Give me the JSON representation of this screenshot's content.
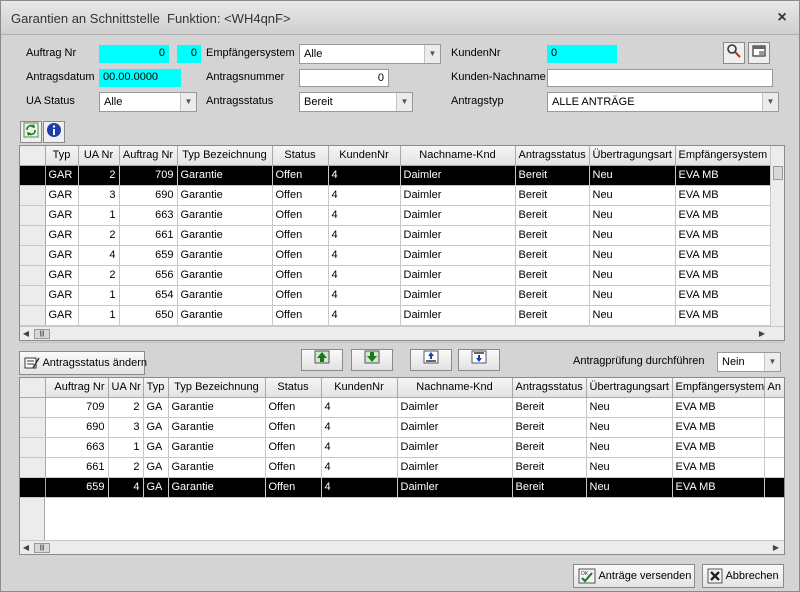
{
  "window": {
    "title": "Garantien an Schnittstelle",
    "function_label": "Funktion: <WH4qnF>",
    "close_label": "×"
  },
  "filters": {
    "auftrag_nr_label": "Auftrag Nr",
    "auftrag_nr_value": "0",
    "auftrag_nr_value2": "0",
    "empfaenger_label": "Empfängersystem",
    "empfaenger_value": "Alle",
    "kundennr_label": "KundenNr",
    "kundennr_value": "0",
    "antragsdatum_label": "Antragsdatum",
    "antragsdatum_value": "00.00.0000",
    "antragsnummer_label": "Antragsnummer",
    "antragsnummer_value": "0",
    "kunden_nachname_label": "Kunden-Nachname",
    "kunden_nachname_value": "",
    "ua_status_label": "UA Status",
    "ua_status_value": "Alle",
    "antragsstatus_label": "Antragsstatus",
    "antragsstatus_value": "Bereit",
    "antragstyp_label": "Antragstyp",
    "antragstyp_value": "ALLE ANTRÄGE"
  },
  "icons": {
    "search": "magnifier-icon",
    "window": "window-icon",
    "refresh": "refresh-icon",
    "info": "info-icon",
    "edit": "edit-icon",
    "up": "arrow-up-icon",
    "down": "arrow-down-icon",
    "top": "move-top-icon",
    "bottom": "move-bottom-icon",
    "ok": "ok-icon",
    "cancel": "cancel-icon"
  },
  "top_grid": {
    "columns": [
      "Typ",
      "UA Nr",
      "Auftrag Nr",
      "Typ Bezeichnung",
      "Status",
      "KundenNr",
      "Nachname-Knd",
      "Antragsstatus",
      "Übertragungsart",
      "Empfängersystem"
    ],
    "rows": [
      [
        "GAR",
        "2",
        "709",
        "Garantie",
        "Offen",
        "4",
        "Daimler",
        "Bereit",
        "Neu",
        "EVA MB"
      ],
      [
        "GAR",
        "3",
        "690",
        "Garantie",
        "Offen",
        "4",
        "Daimler",
        "Bereit",
        "Neu",
        "EVA MB"
      ],
      [
        "GAR",
        "1",
        "663",
        "Garantie",
        "Offen",
        "4",
        "Daimler",
        "Bereit",
        "Neu",
        "EVA MB"
      ],
      [
        "GAR",
        "2",
        "661",
        "Garantie",
        "Offen",
        "4",
        "Daimler",
        "Bereit",
        "Neu",
        "EVA MB"
      ],
      [
        "GAR",
        "4",
        "659",
        "Garantie",
        "Offen",
        "4",
        "Daimler",
        "Bereit",
        "Neu",
        "EVA MB"
      ],
      [
        "GAR",
        "2",
        "656",
        "Garantie",
        "Offen",
        "4",
        "Daimler",
        "Bereit",
        "Neu",
        "EVA MB"
      ],
      [
        "GAR",
        "1",
        "654",
        "Garantie",
        "Offen",
        "4",
        "Daimler",
        "Bereit",
        "Neu",
        "EVA MB"
      ],
      [
        "GAR",
        "1",
        "650",
        "Garantie",
        "Offen",
        "4",
        "Daimler",
        "Bereit",
        "Neu",
        "EVA MB"
      ]
    ]
  },
  "middle": {
    "change_status_label": "Antragsstatus ändern",
    "pruefung_label": "Antragprüfung durchführen",
    "pruefung_value": "Nein"
  },
  "bottom_grid": {
    "columns": [
      "Auftrag Nr",
      "UA Nr",
      "Typ",
      "Typ Bezeichnung",
      "Status",
      "KundenNr",
      "Nachname-Knd",
      "Antragsstatus",
      "Übertragungsart",
      "Empfängersystem",
      "An"
    ],
    "rows": [
      [
        "709",
        "2",
        "GA",
        "Garantie",
        "Offen",
        "4",
        "Daimler",
        "Bereit",
        "Neu",
        "EVA MB"
      ],
      [
        "690",
        "3",
        "GA",
        "Garantie",
        "Offen",
        "4",
        "Daimler",
        "Bereit",
        "Neu",
        "EVA MB"
      ],
      [
        "663",
        "1",
        "GA",
        "Garantie",
        "Offen",
        "4",
        "Daimler",
        "Bereit",
        "Neu",
        "EVA MB"
      ],
      [
        "661",
        "2",
        "GA",
        "Garantie",
        "Offen",
        "4",
        "Daimler",
        "Bereit",
        "Neu",
        "EVA MB"
      ],
      [
        "659",
        "4",
        "GA",
        "Garantie",
        "Offen",
        "4",
        "Daimler",
        "Bereit",
        "Neu",
        "EVA MB"
      ]
    ]
  },
  "footer": {
    "send_label": "Anträge versenden",
    "cancel_label": "Abbrechen"
  }
}
